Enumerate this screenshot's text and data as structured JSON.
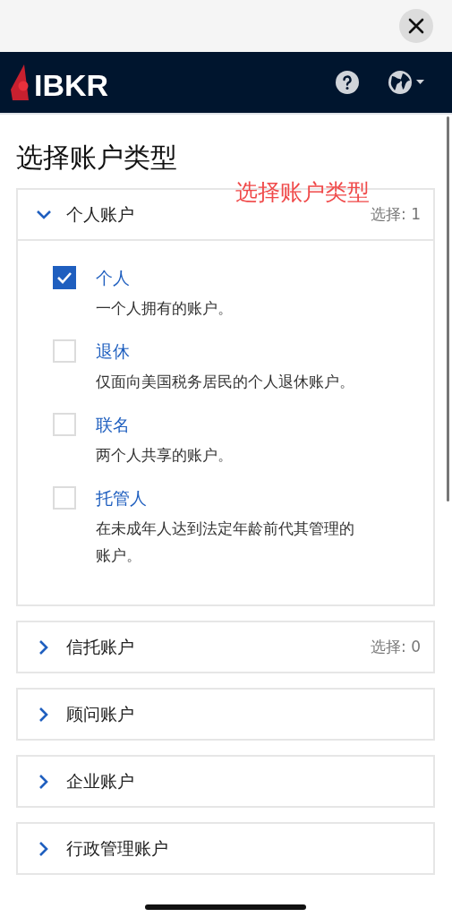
{
  "header": {
    "logo_text": "IBKR"
  },
  "page_title": "选择账户类型",
  "annotation": "选择账户类型",
  "sections": [
    {
      "label": "个人账户",
      "expanded": true,
      "count": "选择: 1",
      "options": [
        {
          "label": "个人",
          "description": "一个人拥有的账户。",
          "checked": true
        },
        {
          "label": "退休",
          "description": "仅面向美国税务居民的个人退休账户。",
          "checked": false
        },
        {
          "label": "联名",
          "description": "两个人共享的账户。",
          "checked": false
        },
        {
          "label": "托管人",
          "description": "在未成年人达到法定年龄前代其管理的账户。",
          "checked": false
        }
      ]
    },
    {
      "label": "信托账户",
      "expanded": false,
      "count": "选择: 0"
    },
    {
      "label": "顾问账户",
      "expanded": false
    },
    {
      "label": "企业账户",
      "expanded": false
    },
    {
      "label": "行政管理账户",
      "expanded": false
    }
  ]
}
